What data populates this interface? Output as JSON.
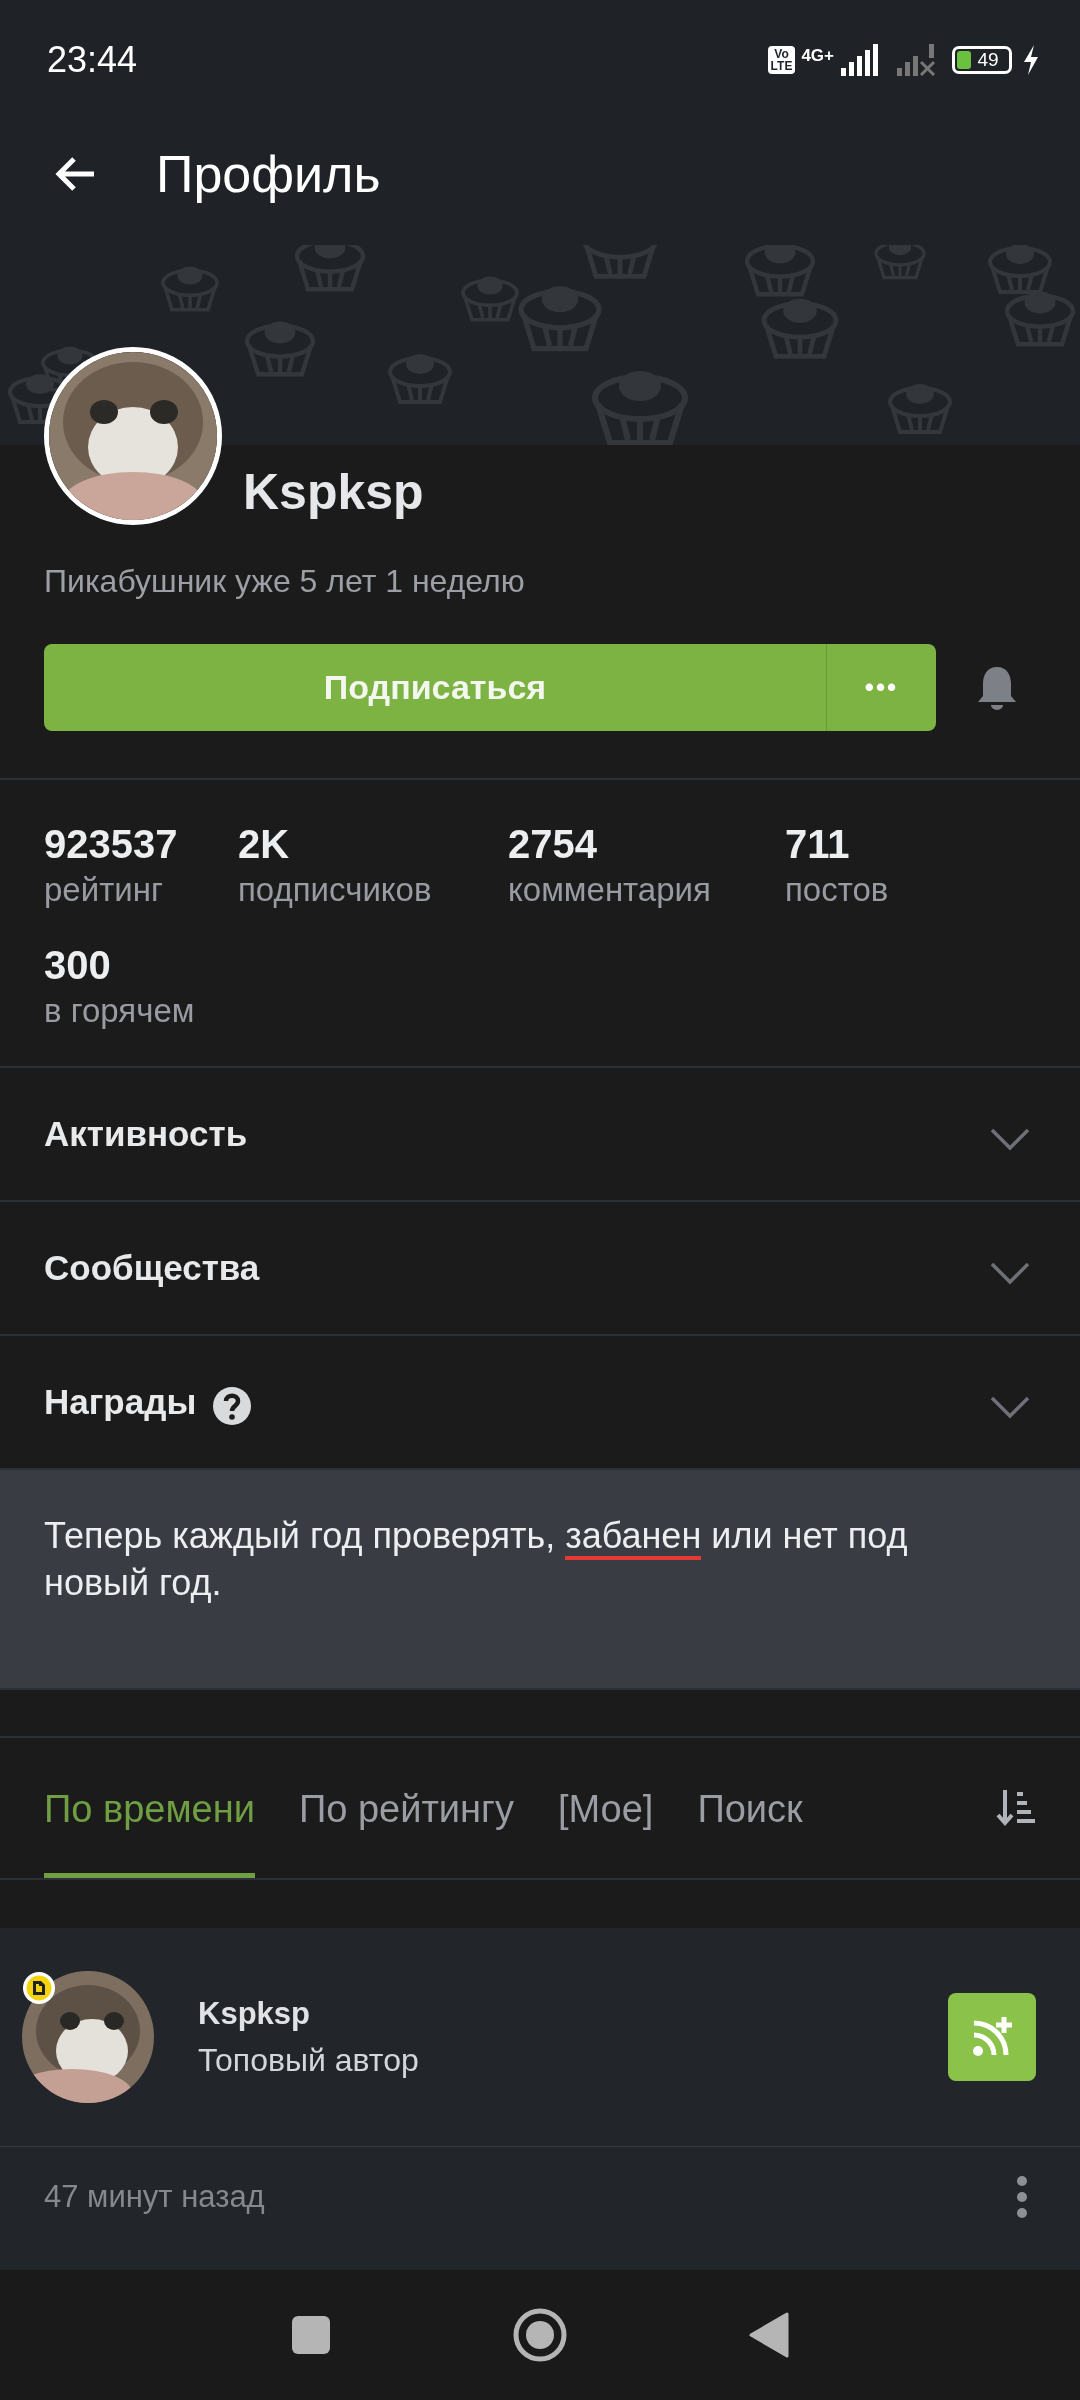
{
  "status_bar": {
    "time": "23:44",
    "volte": [
      "Vo",
      "LTE"
    ],
    "network": "4G+",
    "battery": "49"
  },
  "header": {
    "title": "Профиль"
  },
  "profile": {
    "name": "Kspksp",
    "since": "Пикабушник уже 5 лет 1 неделю",
    "subscribe_label": "Подписаться",
    "more_label": "•••"
  },
  "stats": [
    {
      "value": "923537",
      "label": "рейтинг"
    },
    {
      "value": "2K",
      "label": "подписчиков"
    },
    {
      "value": "2754",
      "label": "комментария"
    },
    {
      "value": "711",
      "label": "постов"
    },
    {
      "value": "300",
      "label": "в горячем"
    }
  ],
  "sections": [
    {
      "title": "Активность",
      "help": false,
      "expanded": false
    },
    {
      "title": "Сообщества",
      "help": false,
      "expanded": false
    },
    {
      "title": "Награды",
      "help": true,
      "expanded": false
    }
  ],
  "note": {
    "segments": [
      {
        "text": "Теперь каждый год проверять, ",
        "misspelled": false
      },
      {
        "text": "забанен",
        "misspelled": true
      },
      {
        "text": " или нет под новый год.",
        "misspelled": false
      }
    ]
  },
  "tabs": [
    {
      "label": "По времени",
      "selected": true
    },
    {
      "label": "По рейтингу",
      "selected": false
    },
    {
      "label": "[Мое]",
      "selected": false
    },
    {
      "label": "Поиск",
      "selected": false
    }
  ],
  "post": {
    "author": "Kspksp",
    "author_status": "Топовый автор",
    "badge": true,
    "time": "47 минут назад"
  }
}
